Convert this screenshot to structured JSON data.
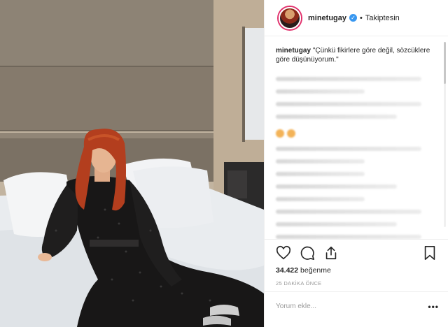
{
  "header": {
    "username": "minetugay",
    "verified_glyph": "✓",
    "separator": "•",
    "follow_status": "Takiptesin"
  },
  "caption": {
    "username": "minetugay",
    "text": "\"Çünkü fikirlere göre değil, sözcüklere göre düşünüyorum.\""
  },
  "actions": {
    "icons": [
      "heart-icon",
      "comment-icon",
      "share-icon",
      "bookmark-icon"
    ],
    "likes_count": "34.422",
    "likes_label": "beğenme",
    "time": "25 DAKİKA ÖNCE"
  },
  "comment_box": {
    "placeholder": "Yorum ekle...",
    "more": "•••"
  },
  "colors": {
    "accent": "#3897f0",
    "story_ring": "#e1306c",
    "text": "#262626",
    "muted": "#999999"
  }
}
